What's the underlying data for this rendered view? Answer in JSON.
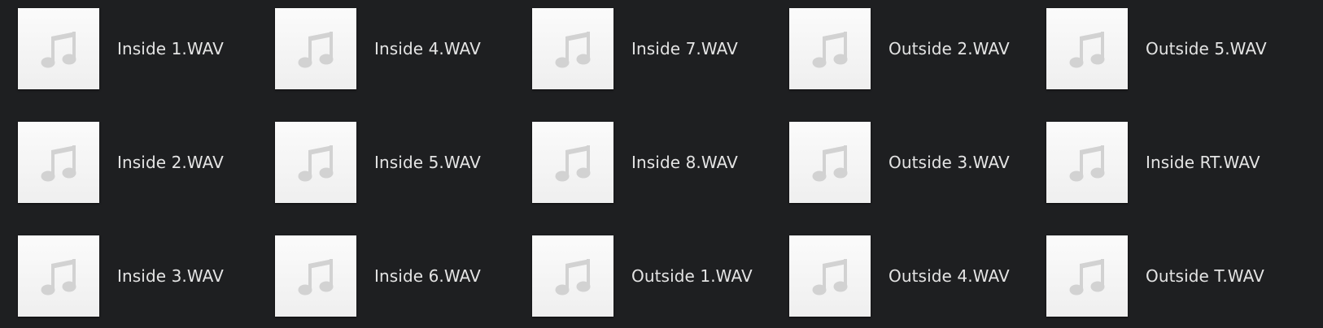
{
  "files": [
    {
      "name": "Inside 1.WAV",
      "icon": "music-note-icon"
    },
    {
      "name": "Inside 4.WAV",
      "icon": "music-note-icon"
    },
    {
      "name": "Inside 7.WAV",
      "icon": "music-note-icon"
    },
    {
      "name": "Outside 2.WAV",
      "icon": "music-note-icon"
    },
    {
      "name": "Outside 5.WAV",
      "icon": "music-note-icon"
    },
    {
      "name": "Inside 2.WAV",
      "icon": "music-note-icon"
    },
    {
      "name": "Inside 5.WAV",
      "icon": "music-note-icon"
    },
    {
      "name": "Inside 8.WAV",
      "icon": "music-note-icon"
    },
    {
      "name": "Outside 3.WAV",
      "icon": "music-note-icon"
    },
    {
      "name": "Inside RT.WAV",
      "icon": "music-note-icon"
    },
    {
      "name": "Inside 3.WAV",
      "icon": "music-note-icon"
    },
    {
      "name": "Inside 6.WAV",
      "icon": "music-note-icon"
    },
    {
      "name": "Outside 1.WAV",
      "icon": "music-note-icon"
    },
    {
      "name": "Outside 4.WAV",
      "icon": "music-note-icon"
    },
    {
      "name": "Outside T.WAV",
      "icon": "music-note-icon"
    }
  ],
  "colors": {
    "background": "#1e1f21",
    "text": "#e4e4e4",
    "thumbnail": "#f4f4f4",
    "note": "#d2d2d2"
  }
}
